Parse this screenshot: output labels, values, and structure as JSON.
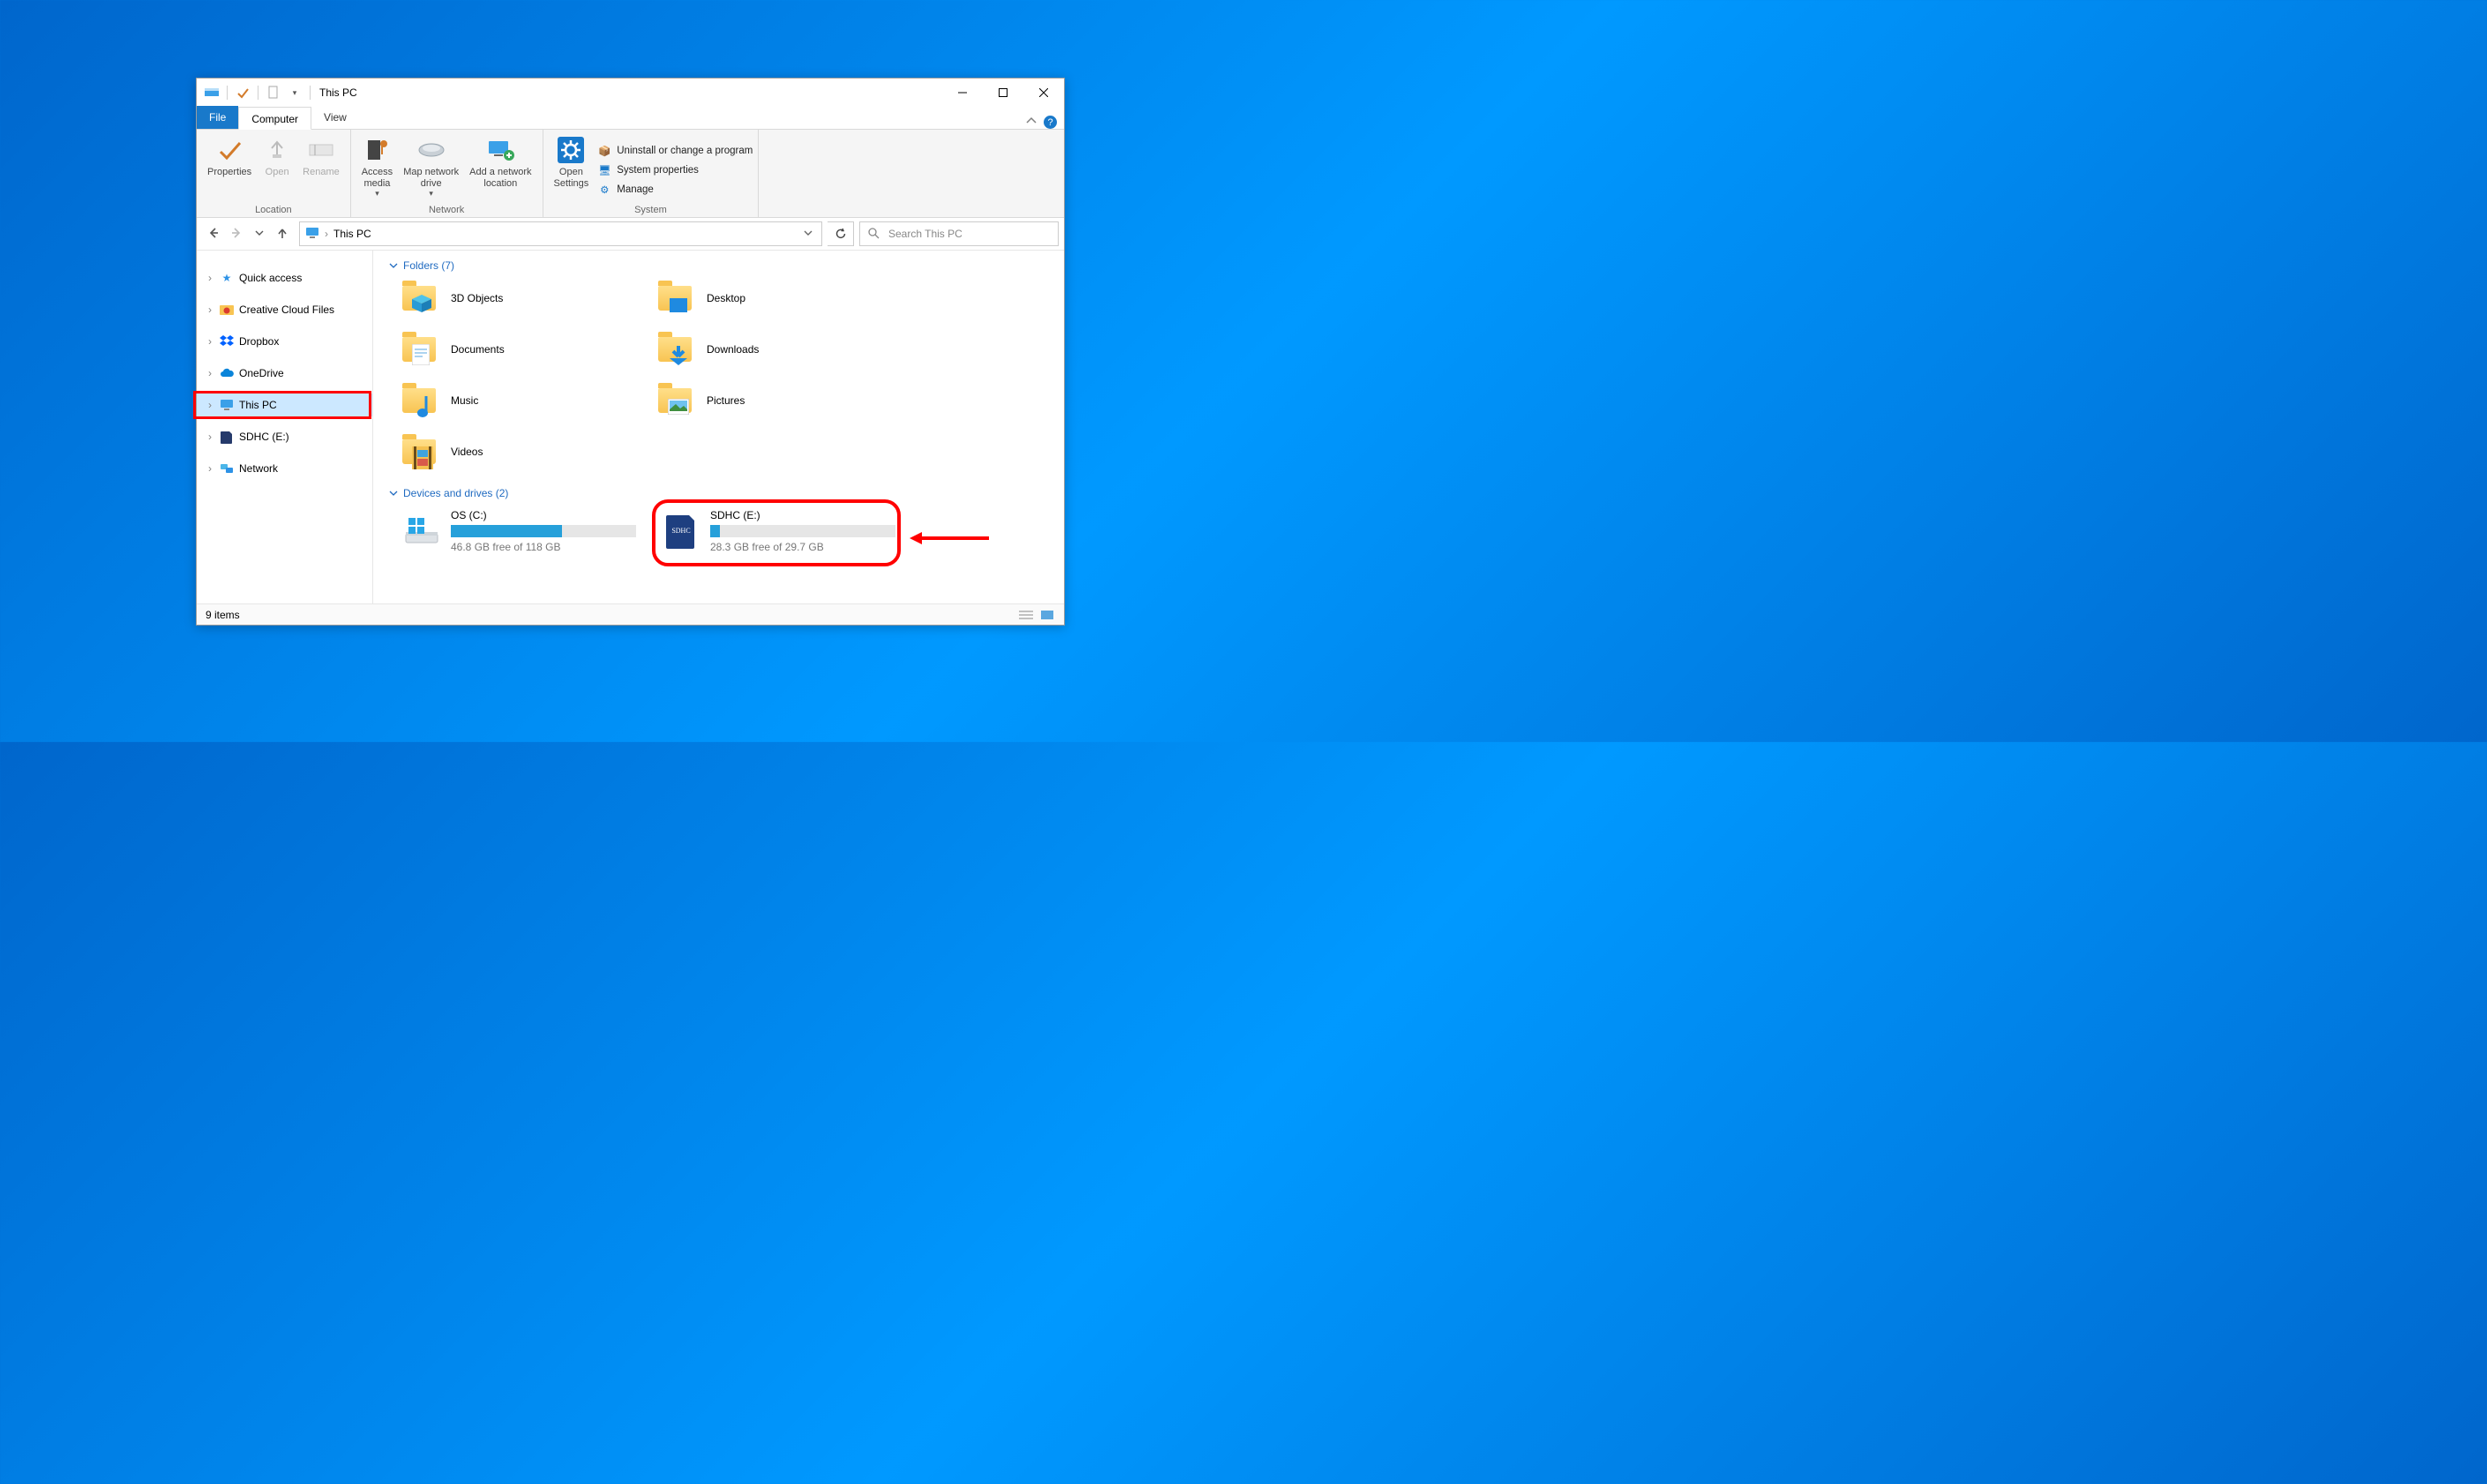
{
  "title": "This PC",
  "tabs": {
    "file": "File",
    "computer": "Computer",
    "view": "View"
  },
  "ribbon": {
    "location": {
      "label": "Location",
      "properties": "Properties",
      "open": "Open",
      "rename": "Rename"
    },
    "network": {
      "label": "Network",
      "access_media": "Access\nmedia",
      "map_drive": "Map network\ndrive",
      "add_location": "Add a network\nlocation"
    },
    "system": {
      "label": "System",
      "open_settings": "Open\nSettings",
      "uninstall": "Uninstall or change a program",
      "properties": "System properties",
      "manage": "Manage"
    }
  },
  "breadcrumb": "This PC",
  "search_placeholder": "Search This PC",
  "sidebar": [
    {
      "key": "quick",
      "label": "Quick access"
    },
    {
      "key": "ccf",
      "label": "Creative Cloud Files"
    },
    {
      "key": "dropbox",
      "label": "Dropbox"
    },
    {
      "key": "onedrive",
      "label": "OneDrive"
    },
    {
      "key": "thispc",
      "label": "This PC"
    },
    {
      "key": "sdhc",
      "label": "SDHC (E:)"
    },
    {
      "key": "network",
      "label": "Network"
    }
  ],
  "sections": {
    "folders_header": "Folders (7)",
    "drives_header": "Devices and drives (2)"
  },
  "folders": [
    {
      "name": "3D Objects"
    },
    {
      "name": "Desktop"
    },
    {
      "name": "Documents"
    },
    {
      "name": "Downloads"
    },
    {
      "name": "Music"
    },
    {
      "name": "Pictures"
    },
    {
      "name": "Videos"
    }
  ],
  "drives": [
    {
      "name": "OS (C:)",
      "free": "46.8 GB free of 118 GB",
      "fill_pct": 60
    },
    {
      "name": "SDHC (E:)",
      "free": "28.3 GB free of 29.7 GB",
      "fill_pct": 5
    }
  ],
  "status": {
    "items": "9 items"
  }
}
